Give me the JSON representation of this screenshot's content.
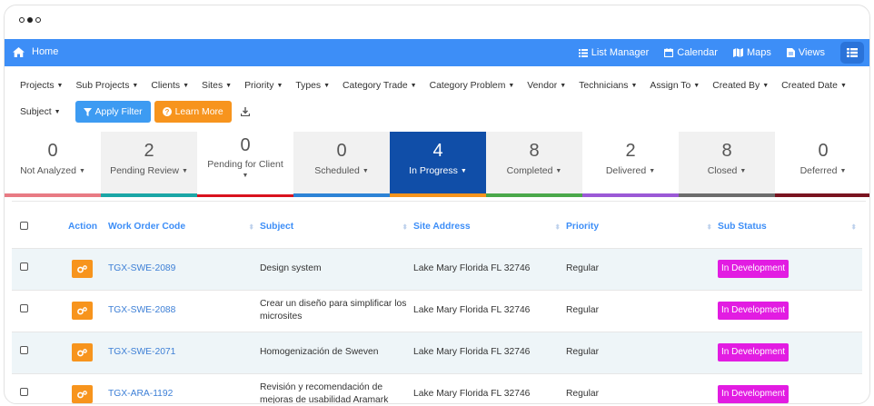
{
  "nav": {
    "home_label": "Home",
    "items": [
      {
        "label": "List Manager",
        "icon": "list-icon"
      },
      {
        "label": "Calendar",
        "icon": "calendar-icon"
      },
      {
        "label": "Maps",
        "icon": "map-icon"
      },
      {
        "label": "Views",
        "icon": "file-icon"
      }
    ],
    "list_view_icon": "list-view-icon",
    "color": "#3d8ef7"
  },
  "filters": {
    "row1": [
      "Projects",
      "Sub Projects",
      "Clients",
      "Sites",
      "Priority",
      "Types",
      "Category Trade",
      "Category Problem",
      "Vendor",
      "Technicians",
      "Assign To",
      "Created By",
      "Created Date"
    ],
    "row2_subject": "Subject",
    "apply_label": "Apply Filter",
    "learn_label": "Learn More"
  },
  "statuses": [
    {
      "count": "0",
      "label": "Not Analyzed",
      "color": "#e87b84"
    },
    {
      "count": "2",
      "label": "Pending Review",
      "color": "#1ba6a6"
    },
    {
      "count": "0",
      "label": "Pending for Client",
      "color": "#d9121e"
    },
    {
      "count": "0",
      "label": "Scheduled",
      "color": "#2d83d6"
    },
    {
      "count": "4",
      "label": "In Progress",
      "color": "#f7941d"
    },
    {
      "count": "8",
      "label": "Completed",
      "color": "#4aa84a"
    },
    {
      "count": "2",
      "label": "Delivered",
      "color": "#9b59d6"
    },
    {
      "count": "8",
      "label": "Closed",
      "color": "#6d6d6d"
    },
    {
      "count": "0",
      "label": "Deferred",
      "color": "#7a1420"
    }
  ],
  "table": {
    "headers": {
      "action": "Action",
      "code": "Work Order Code",
      "subject": "Subject",
      "site": "Site Address",
      "priority": "Priority",
      "sub_status": "Sub Status"
    },
    "rows": [
      {
        "code": "TGX-SWE-2089",
        "subject": "Design system",
        "site": "Lake Mary Florida FL 32746",
        "priority": "Regular",
        "sub_status": "In Development"
      },
      {
        "code": "TGX-SWE-2088",
        "subject": "Crear un diseño para simplificar los microsites",
        "site": "Lake Mary Florida FL 32746",
        "priority": "Regular",
        "sub_status": "In Development"
      },
      {
        "code": "TGX-SWE-2071",
        "subject": "Homogenización de Sweven",
        "site": "Lake Mary Florida FL 32746",
        "priority": "Regular",
        "sub_status": "In Development"
      },
      {
        "code": "TGX-ARA-1192",
        "subject": "Revisión y recomendación de mejoras de usabilidad Aramark",
        "site": "Lake Mary Florida FL 32746",
        "priority": "Regular",
        "sub_status": "In Development"
      }
    ]
  },
  "colors": {
    "accent": "#3d8ef7",
    "active_tile": "#104ea8",
    "action_button": "#f7941d",
    "badge": "#e21ce2"
  }
}
